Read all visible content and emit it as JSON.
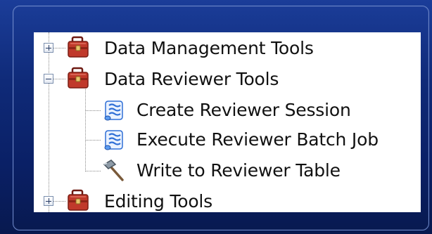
{
  "tree": {
    "items": [
      {
        "label": "Data Management Tools",
        "icon": "toolbox-icon",
        "state": "collapsed"
      },
      {
        "label": "Data Reviewer Tools",
        "icon": "toolbox-icon",
        "state": "expanded"
      },
      {
        "label": "Create Reviewer Session",
        "icon": "script-tool-icon"
      },
      {
        "label": "Execute Reviewer Batch Job",
        "icon": "script-tool-icon"
      },
      {
        "label": "Write to Reviewer Table",
        "icon": "hammer-tool-icon"
      },
      {
        "label": "Editing Tools",
        "icon": "toolbox-icon",
        "state": "collapsed"
      }
    ]
  },
  "colors": {
    "background": "#0f2a78",
    "toolbox": "#c0392b",
    "script": "#2f6fd6"
  }
}
